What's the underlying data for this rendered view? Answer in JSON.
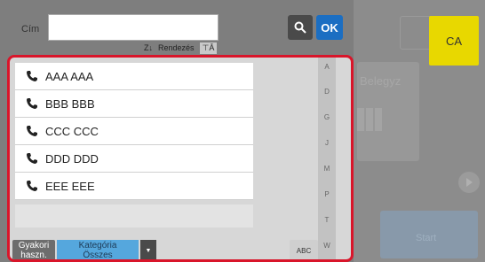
{
  "header": {
    "title_label": "Cím",
    "search_value": "",
    "ok_label": "OK",
    "sort_label": "Rendezés"
  },
  "background": {
    "label": "Belegyz",
    "start_label": "Start"
  },
  "ca_label": "CA",
  "list": {
    "items": [
      {
        "label": "AAA AAA",
        "icon": "phone-icon"
      },
      {
        "label": "BBB BBB",
        "icon": "phone-icon"
      },
      {
        "label": "CCC CCC",
        "icon": "phone-icon"
      },
      {
        "label": "DDD DDD",
        "icon": "phone-icon"
      },
      {
        "label": "EEE EEE",
        "icon": "phone-icon"
      }
    ]
  },
  "alphabet": [
    "A",
    "D",
    "G",
    "J",
    "M",
    "P",
    "T",
    "W"
  ],
  "footer": {
    "frequent_line1": "Gyakori",
    "frequent_line2": "haszn.",
    "category_line1": "Kategória",
    "category_line2": "Összes",
    "abc_label": "ABC"
  },
  "colors": {
    "frame": "#d9152a",
    "ok": "#1b6ec2",
    "ca": "#e8d800",
    "category": "#55a7dd"
  }
}
